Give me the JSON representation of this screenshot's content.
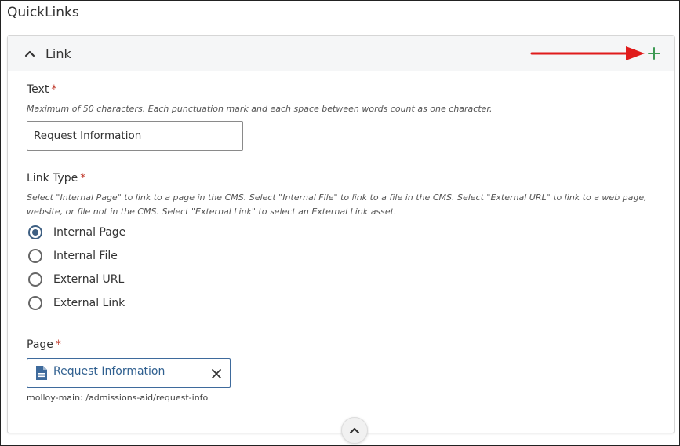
{
  "section": {
    "title": "QuickLinks"
  },
  "panel": {
    "title": "Link"
  },
  "text_field": {
    "label": "Text",
    "required_mark": "*",
    "help": "Maximum of 50 characters. Each punctuation mark and each space between words count as one character.",
    "value": "Request Information"
  },
  "link_type": {
    "label": "Link Type",
    "required_mark": "*",
    "help": "Select \"Internal Page\" to link to a page in the CMS. Select \"Internal File\" to link to a file in the CMS. Select \"External URL\" to link to a web page, website, or file not in the CMS. Select \"External Link\" to select an External Link asset.",
    "options": [
      "Internal Page",
      "Internal File",
      "External URL",
      "External Link"
    ],
    "selected": "Internal Page"
  },
  "page_field": {
    "label": "Page",
    "required_mark": "*",
    "selected_page": "Request Information",
    "path": "molloy-main: /admissions-aid/request-info"
  },
  "colors": {
    "accent": "#3e5f82",
    "link": "#2f5f8f",
    "add": "#3d9a54",
    "required": "#c0392b",
    "annotation_arrow": "#e01b1b"
  },
  "icons": {
    "collapse": "chevron-up-icon",
    "add": "plus-icon",
    "page": "document-icon",
    "remove": "close-icon",
    "scroll": "chevron-up-icon"
  }
}
